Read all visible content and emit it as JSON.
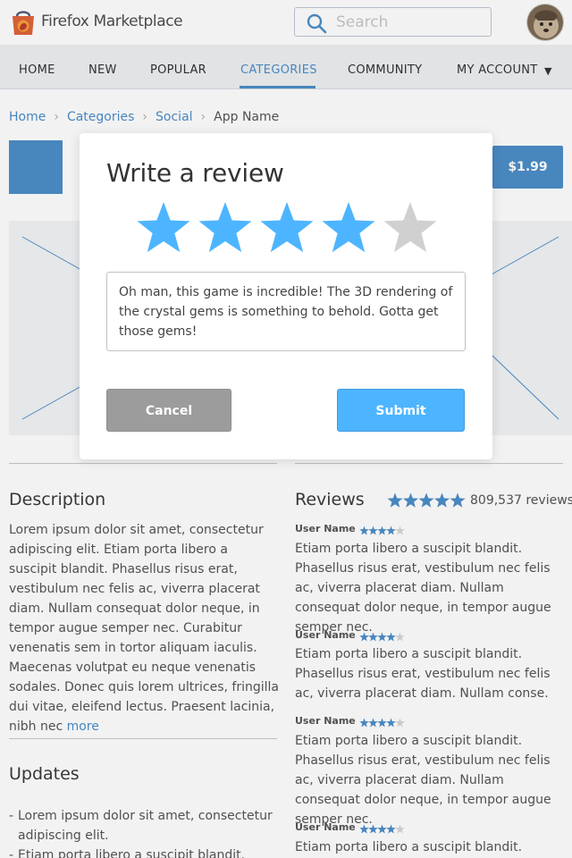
{
  "header": {
    "brand": "Firefox Marketplace",
    "search_placeholder": "Search"
  },
  "nav": {
    "items": [
      "HOME",
      "NEW",
      "POPULAR",
      "CATEGORIES",
      "COMMUNITY",
      "MY ACCOUNT"
    ],
    "active": "CATEGORIES"
  },
  "breadcrumb": [
    "Home",
    "Categories",
    "Social",
    "App Name"
  ],
  "app": {
    "price": "$1.99"
  },
  "description": {
    "heading": "Description",
    "text": "Lorem ipsum dolor sit amet, consectetur adipiscing elit. Etiam porta libero a suscipit blandit. Phasellus risus erat, vestibulum nec felis ac, viverra placerat diam. Nullam consequat dolor neque, in tempor augue semper nec. Curabitur venenatis sem in tortor aliquam iaculis. Maecenas volutpat eu neque venenatis sodales. Donec quis lorem ultrices, fringilla dui vitae, eleifend lectus. Praesent lacinia, nibh nec",
    "more": "more"
  },
  "updates": {
    "heading": "Updates",
    "items": [
      "Lorem ipsum dolor sit amet, consectetur adipiscing elit.",
      "Etiam porta libero a suscipit blandit."
    ]
  },
  "reviews": {
    "heading": "Reviews",
    "overall_rating": 5,
    "count": "809,537 reviews",
    "list": [
      {
        "user": "User Name",
        "rating": 4,
        "text": "Etiam porta libero a suscipit blandit. Phasellus risus erat, vestibulum nec felis ac, viverra placerat diam. Nullam consequat dolor neque, in tempor augue semper nec."
      },
      {
        "user": "User Name",
        "rating": 4,
        "text": "Etiam porta libero a suscipit blandit. Phasellus risus erat, vestibulum nec felis ac, viverra placerat diam. Nullam conse."
      },
      {
        "user": "User Name",
        "rating": 4,
        "text": "Etiam porta libero a suscipit blandit. Phasellus risus erat, vestibulum nec felis ac, viverra placerat diam. Nullam consequat dolor neque, in tempor augue semper nec."
      },
      {
        "user": "User Name",
        "rating": 4,
        "text": "Etiam porta libero a suscipit blandit."
      }
    ]
  },
  "modal": {
    "title": "Write a review",
    "rating": 4,
    "max_rating": 5,
    "review_text": "Oh man, this game is incredible! The 3D rendering of the crystal gems is something to behold. Gotta get those gems!",
    "cancel_label": "Cancel",
    "submit_label": "Submit"
  },
  "colors": {
    "accent": "#4c8ec9",
    "star_active": "#4db5ff",
    "star_inactive": "#d0d0d0",
    "submit": "#4db5ff",
    "cancel": "#9c9c9c"
  }
}
